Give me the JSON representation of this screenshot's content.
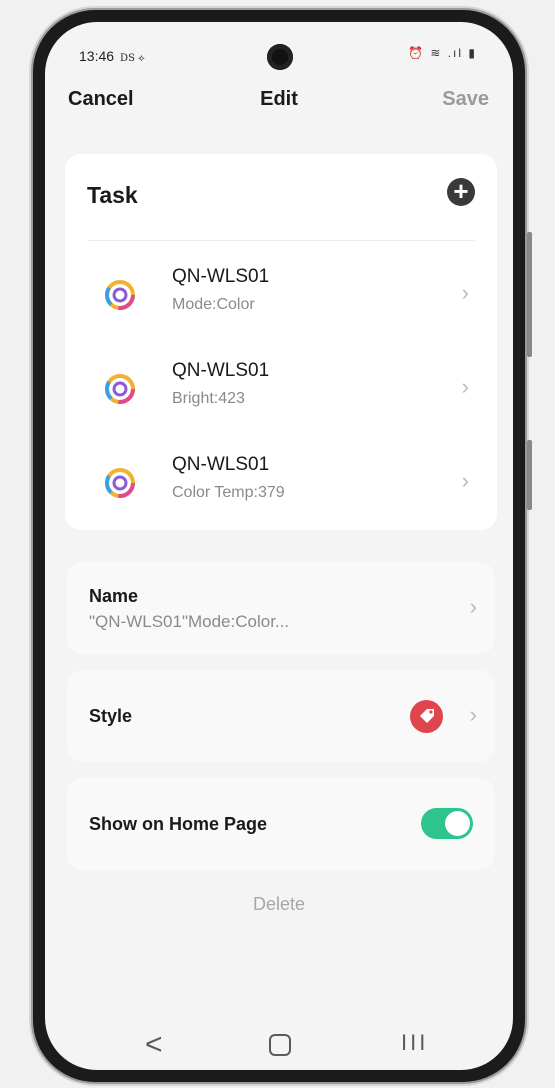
{
  "status_bar": {
    "time": "13:46",
    "tags": "DS ⟡",
    "right_icons": "⏰ ≋ .ıl ▮"
  },
  "header": {
    "cancel": "Cancel",
    "title": "Edit",
    "save": "Save"
  },
  "task": {
    "title": "Task",
    "add_icon": "plus-circle-icon",
    "items": [
      {
        "device": "QN-WLS01",
        "detail": "Mode:Color"
      },
      {
        "device": "QN-WLS01",
        "detail": "Bright:423"
      },
      {
        "device": "QN-WLS01",
        "detail": "Color Temp:379"
      }
    ]
  },
  "name": {
    "label": "Name",
    "value": "\"QN-WLS01\"Mode:Color..."
  },
  "style": {
    "label": "Style",
    "icon": "tag-icon",
    "icon_color": "#e0444c"
  },
  "home": {
    "label": "Show on Home Page",
    "toggle_on": true,
    "toggle_color": "#2dc48d"
  },
  "delete_label": "Delete",
  "nav": {
    "back": "<",
    "recent": "III"
  }
}
